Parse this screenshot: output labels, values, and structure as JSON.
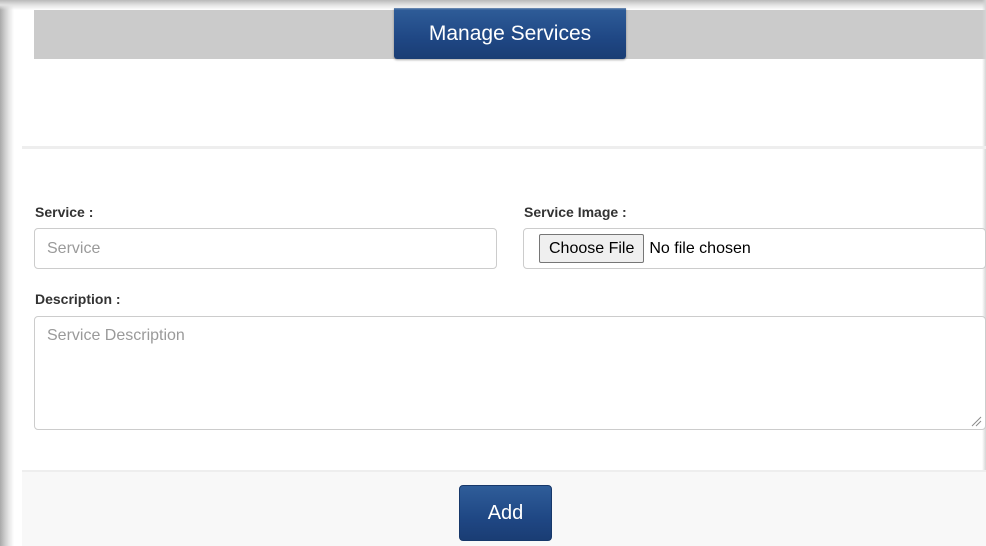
{
  "header": {
    "title": "Manage Services"
  },
  "form": {
    "service": {
      "label": "Service :",
      "placeholder": "Service",
      "value": ""
    },
    "service_image": {
      "label": "Service Image :",
      "button_label": "Choose File",
      "status": "No file chosen"
    },
    "description": {
      "label": "Description :",
      "placeholder": "Service Description",
      "value": ""
    }
  },
  "footer": {
    "add_label": "Add"
  },
  "colors": {
    "primary_button": "#1f4784",
    "header_band": "#cbcbcb",
    "label_text": "#333333",
    "input_border": "#cccccc"
  },
  "icons": {
    "resize_handle": "textarea-resize-grip-icon"
  }
}
